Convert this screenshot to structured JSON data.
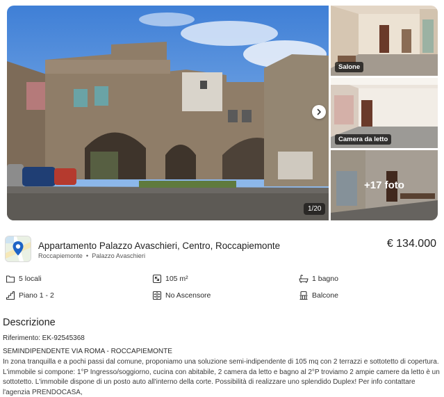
{
  "gallery": {
    "counter": "1/20",
    "thumbnails": [
      {
        "label": "Salone"
      },
      {
        "label": "Camera da letto"
      },
      {
        "label": "",
        "more_photos": "+17 foto"
      }
    ]
  },
  "listing": {
    "title": "Appartamento Palazzo Avaschieri, Centro, Roccapiemonte",
    "city": "Roccapiemonte",
    "separator": "•",
    "zone": "Palazzo Avaschieri",
    "price": "€ 134.000"
  },
  "features": {
    "rooms": "5 locali",
    "area": "105 m²",
    "bathrooms": "1 bagno",
    "floor": "Piano 1 - 2",
    "elevator": "No Ascensore",
    "balcony": "Balcone"
  },
  "description": {
    "heading": "Descrizione",
    "reference": "Riferimento: EK-92545368",
    "title": "SEMINDIPENDENTE VIA ROMA - ROCCAPIEMONTE",
    "body": "In zona tranquilla e a pochi passi dal comune, proponiamo una soluzione semi-indipendente di 105 mq con 2 terrazzi e sottotetto di copertura. L'immobile si compone: 1°P Ingresso/soggiorno, cucina con abitabile, 2 camera da letto e bagno al 2°P troviamo 2 ampie camere da letto è un sottotetto. L'immobile dispone di un posto auto all'interno della corte. Possibilità di realizzare uno splendido Duplex! Per info contattare l'agenzia PRENDOCASA,"
  }
}
